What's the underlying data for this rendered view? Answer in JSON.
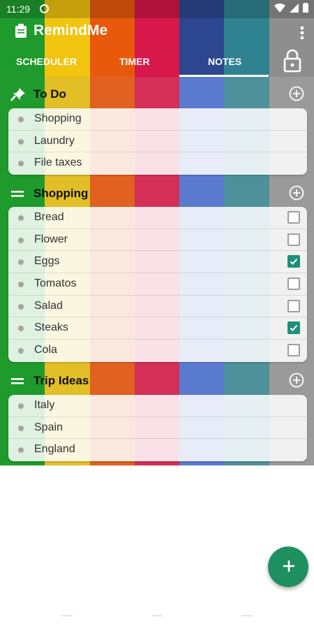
{
  "status_bar": {
    "time": "11:29"
  },
  "app": {
    "title": "RemindMe"
  },
  "tabs": [
    {
      "label": "SCHEDULER"
    },
    {
      "label": "TIMER"
    },
    {
      "label": "NOTES"
    }
  ],
  "colors": {
    "stripes": [
      "#1f9a2c",
      "#f1c40f",
      "#e8590c",
      "#d6184a",
      "#2c4790",
      "#2f8391",
      "#8e8e8e"
    ],
    "fab": "#1e8f5f",
    "checkbox_checked": "#1e8f79"
  },
  "notes": [
    {
      "title": "To Do",
      "icon": "pin-icon",
      "items": [
        {
          "label": "Shopping"
        },
        {
          "label": "Laundry"
        },
        {
          "label": "File taxes"
        }
      ]
    },
    {
      "title": "Shopping",
      "icon": "drag-handle-icon",
      "items": [
        {
          "label": "Bread",
          "checked": false
        },
        {
          "label": "Flower",
          "checked": false
        },
        {
          "label": "Eggs",
          "checked": true
        },
        {
          "label": "Tomatos",
          "checked": false
        },
        {
          "label": "Salad",
          "checked": false
        },
        {
          "label": "Steaks",
          "checked": true
        },
        {
          "label": "Cola",
          "checked": false
        }
      ]
    },
    {
      "title": "Trip Ideas",
      "icon": "drag-handle-icon",
      "items": [
        {
          "label": "Italy"
        },
        {
          "label": "Spain"
        },
        {
          "label": "England"
        }
      ]
    }
  ]
}
